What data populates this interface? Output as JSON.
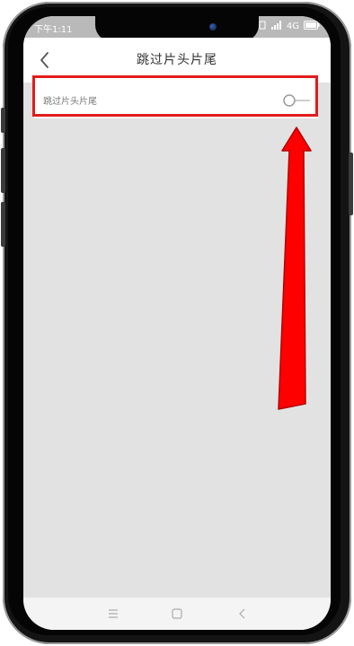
{
  "status_bar": {
    "time": "下午1:11",
    "network": "4G"
  },
  "header": {
    "title": "跳过片头片尾",
    "back_icon": "chevron-left-icon"
  },
  "settings": {
    "items": [
      {
        "label": "跳过片头片尾",
        "enabled": false
      }
    ]
  },
  "bottom_nav": {
    "menu_icon": "menu-icon",
    "home_icon": "square-icon",
    "back_icon": "chevron-left-icon"
  },
  "colors": {
    "highlight": "#e21b1b",
    "arrow": "#ff0000",
    "background": "#e2e2e2"
  }
}
